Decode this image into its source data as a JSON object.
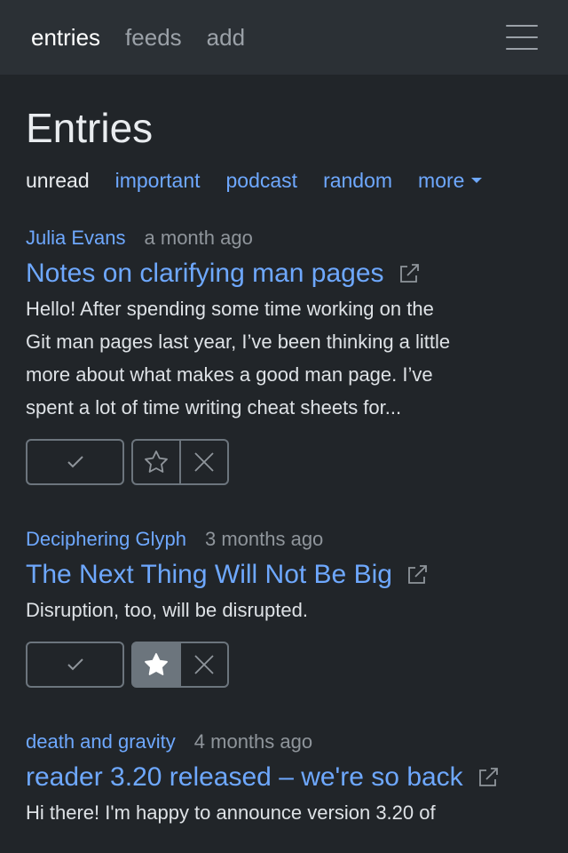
{
  "nav": {
    "items": [
      "entries",
      "feeds",
      "add"
    ],
    "active": "entries",
    "menu_icon": "hamburger-icon"
  },
  "page": {
    "title": "Entries",
    "filters": [
      "unread",
      "important",
      "podcast",
      "random",
      "more"
    ],
    "current_filter": "unread"
  },
  "entries": [
    {
      "feed": "Julia Evans",
      "time": "a month ago",
      "title": "Notes on clarifying man pages",
      "summary_lines": [
        "Hello! After spending some time working on the",
        "Git man pages last year, I’ve been thinking a little",
        "more about what makes a good man page. I’ve",
        "spent a lot of time writing cheat sheets for..."
      ],
      "important": false
    },
    {
      "feed": "Deciphering Glyph",
      "time": "3 months ago",
      "title": "The Next Thing Will Not Be Big",
      "summary_lines": [
        "Disruption, too, will be disrupted."
      ],
      "important": true
    },
    {
      "feed": "death and gravity",
      "time": "4 months ago",
      "title": "reader 3.20 released – we're so back",
      "summary_lines": [
        "Hi there! I'm happy to announce version 3.20 of"
      ],
      "important": false
    }
  ],
  "colors": {
    "background": "#212529",
    "navbar": "#2b3035",
    "link": "#6ea8fe",
    "muted": "#8f959b",
    "button_border": "#6c757d"
  },
  "icons": [
    "check-icon",
    "star-icon",
    "x-icon",
    "external-link-icon"
  ]
}
